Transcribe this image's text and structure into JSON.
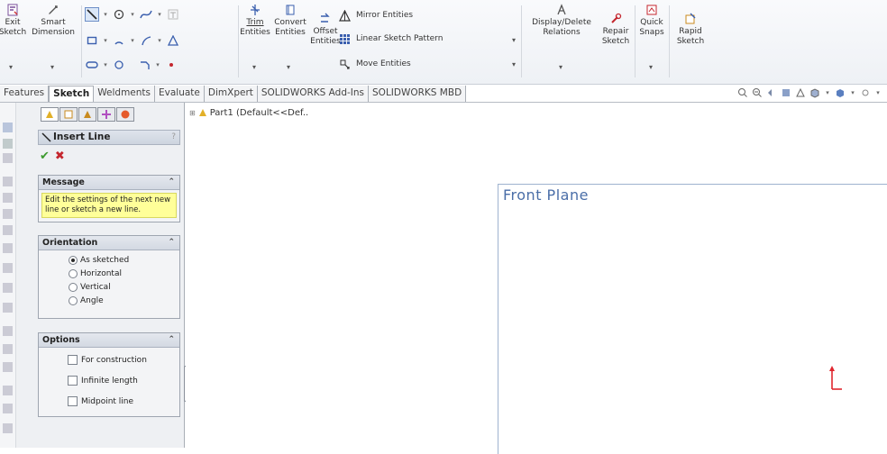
{
  "ribbon": {
    "exit_sketch_line1": "Exit",
    "exit_sketch_line2": "Sketch",
    "smart_dimension_line1": "Smart",
    "smart_dimension_line2": "Dimension",
    "trim_line1": "Trim",
    "trim_line2": "Entities",
    "convert_line1": "Convert",
    "convert_line2": "Entities",
    "offset_line1": "Offset",
    "offset_line2": "Entities",
    "mirror_entities": "Mirror Entities",
    "linear_sketch_pattern": "Linear Sketch Pattern",
    "move_entities": "Move Entities",
    "display_delete_line1": "Display/Delete",
    "display_delete_line2": "Relations",
    "repair_line1": "Repair",
    "repair_line2": "Sketch",
    "quick_snaps_line1": "Quick",
    "quick_snaps_line2": "Snaps",
    "rapid_sketch_line1": "Rapid",
    "rapid_sketch_line2": "Sketch"
  },
  "tabs": [
    {
      "label": "Features"
    },
    {
      "label": "Sketch"
    },
    {
      "label": "Weldments"
    },
    {
      "label": "Evaluate"
    },
    {
      "label": "DimXpert"
    },
    {
      "label": "SOLIDWORKS Add-Ins"
    },
    {
      "label": "SOLIDWORKS MBD"
    }
  ],
  "active_tab": "Sketch",
  "property_manager": {
    "title": "Insert Line",
    "help": "?",
    "message": {
      "header": "Message",
      "text": "Edit the settings of the next new line or sketch a new line."
    },
    "orientation": {
      "header": "Orientation",
      "options": [
        {
          "label": "As sketched",
          "selected": true
        },
        {
          "label": "Horizontal",
          "selected": false
        },
        {
          "label": "Vertical",
          "selected": false
        },
        {
          "label": "Angle",
          "selected": false
        }
      ]
    },
    "options": {
      "header": "Options",
      "items": [
        {
          "label": "For construction",
          "checked": false
        },
        {
          "label": "Infinite length",
          "checked": false
        },
        {
          "label": "Midpoint line",
          "checked": false
        }
      ]
    }
  },
  "graphics": {
    "tree_item": "Part1  (Default<<Def..",
    "plane_label": "Front Plane"
  },
  "colors": {
    "accent": "#4a6ea8",
    "ok": "#3d9a2f",
    "cancel": "#c4262e",
    "message_bg": "#ffff99",
    "triad": "#e0262e"
  }
}
